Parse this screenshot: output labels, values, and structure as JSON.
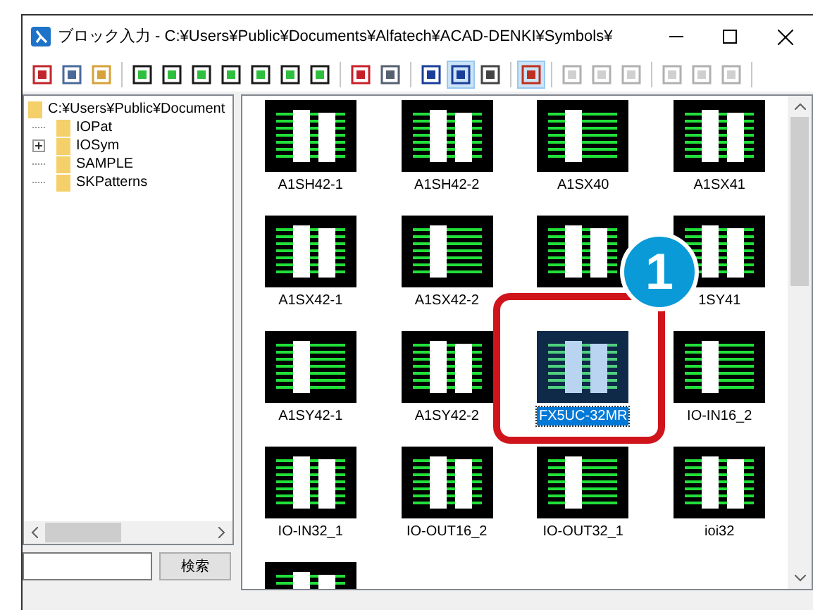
{
  "window": {
    "title": "ブロック入力 - C:¥Users¥Public¥Documents¥Alfatech¥ACAD-DENKI¥Symbols¥"
  },
  "toolbar": [
    {
      "kind": "button",
      "selected": false,
      "disabled": false
    },
    {
      "kind": "button",
      "selected": false,
      "disabled": false
    },
    {
      "kind": "button",
      "selected": false,
      "disabled": false
    },
    {
      "kind": "separator"
    },
    {
      "kind": "button",
      "selected": false,
      "disabled": false
    },
    {
      "kind": "button",
      "selected": false,
      "disabled": false
    },
    {
      "kind": "button",
      "selected": false,
      "disabled": false
    },
    {
      "kind": "button",
      "selected": false,
      "disabled": false
    },
    {
      "kind": "button",
      "selected": false,
      "disabled": false
    },
    {
      "kind": "button",
      "selected": false,
      "disabled": false
    },
    {
      "kind": "button",
      "selected": false,
      "disabled": false
    },
    {
      "kind": "separator"
    },
    {
      "kind": "button",
      "selected": false,
      "disabled": false
    },
    {
      "kind": "button",
      "selected": false,
      "disabled": false
    },
    {
      "kind": "separator"
    },
    {
      "kind": "button",
      "selected": false,
      "disabled": false
    },
    {
      "kind": "button",
      "selected": true,
      "disabled": false
    },
    {
      "kind": "button",
      "selected": false,
      "disabled": false
    },
    {
      "kind": "separator"
    },
    {
      "kind": "button",
      "selected": true,
      "disabled": false
    },
    {
      "kind": "separator"
    },
    {
      "kind": "button",
      "selected": false,
      "disabled": true
    },
    {
      "kind": "button",
      "selected": false,
      "disabled": true
    },
    {
      "kind": "button",
      "selected": false,
      "disabled": true
    },
    {
      "kind": "separator"
    },
    {
      "kind": "button",
      "selected": false,
      "disabled": true
    },
    {
      "kind": "button",
      "selected": false,
      "disabled": true
    },
    {
      "kind": "button",
      "selected": false,
      "disabled": true
    },
    {
      "kind": "separator"
    }
  ],
  "tree": {
    "label": "C:¥Users¥Public¥Document",
    "children": [
      {
        "label": "IOPat"
      },
      {
        "label": "IOSym",
        "expanded": false
      },
      {
        "label": "SAMPLE"
      },
      {
        "label": "SKPatterns"
      }
    ]
  },
  "search": {
    "button": "検索"
  },
  "blocks": [
    {
      "label": "A1SH42-1",
      "selected": false
    },
    {
      "label": "A1SH42-2",
      "selected": false
    },
    {
      "label": "A1SX40",
      "selected": false
    },
    {
      "label": "A1SX41",
      "selected": false
    },
    {
      "label": "A1SX42-1",
      "selected": false
    },
    {
      "label": "A1SX42-2",
      "selected": false
    },
    {
      "selected": false
    },
    {
      "label": "1SY41",
      "selected": false
    },
    {
      "label": "A1SY42-1",
      "selected": false
    },
    {
      "label": "A1SY42-2",
      "selected": false
    },
    {
      "label": "FX5UC-32MR",
      "selected": true
    },
    {
      "label": "IO-IN16_2",
      "selected": false
    },
    {
      "label": "IO-IN32_1",
      "selected": false
    },
    {
      "label": "IO-OUT16_2",
      "selected": false
    },
    {
      "label": "IO-OUT32_1",
      "selected": false
    },
    {
      "label": "ioi32",
      "selected": false
    },
    {
      "selected": false
    }
  ],
  "callout": {
    "number": "1"
  }
}
